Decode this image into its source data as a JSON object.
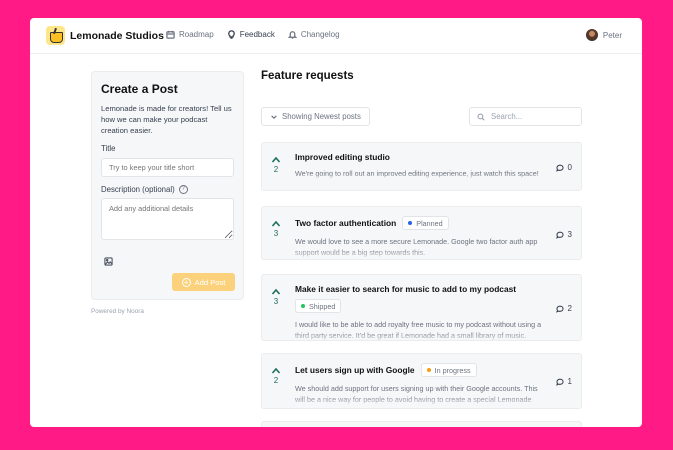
{
  "header": {
    "brand": "Lemonade Studios",
    "nav": [
      {
        "label": "Roadmap",
        "icon": "calendar-icon"
      },
      {
        "label": "Feedback",
        "icon": "lightbulb-icon"
      },
      {
        "label": "Changelog",
        "icon": "bell-icon"
      }
    ],
    "user": "Peter"
  },
  "create_post": {
    "title": "Create a Post",
    "description": "Lemonade is made for creators! Tell us how we can make your podcast creation easier.",
    "title_label": "Title",
    "title_placeholder": "Try to keep your title short",
    "desc_label": "Description (optional)",
    "desc_placeholder": "Add any additional details",
    "submit_label": "Add Post"
  },
  "footer": {
    "powered_by": "Powered by Noora"
  },
  "feed": {
    "title": "Feature requests",
    "sort_label": "Showing Newest posts",
    "search_placeholder": "Search...",
    "posts": [
      {
        "title": "Improved editing studio",
        "votes": "2",
        "comments": "0",
        "status": "",
        "desc": "We're going to roll out an improved editing experience, just watch this space!"
      },
      {
        "title": "Two factor authentication",
        "votes": "3",
        "comments": "3",
        "status": "Planned",
        "status_color": "#2563eb",
        "desc": "We would love to see a more secure Lemonade. Google two factor auth app support would be a big step towards this."
      },
      {
        "title": "Make it easier to search for music to add to my podcast",
        "votes": "3",
        "comments": "2",
        "status": "Shipped",
        "status_color": "#22c55e",
        "desc": "I would like to be able to add royalty free music to my podcast without using a third party service. It'd be great if Lemonade had a small library of music."
      },
      {
        "title": "Let users sign up with Google",
        "votes": "2",
        "comments": "1",
        "status": "In progress",
        "status_color": "#f59e0b",
        "desc": "We should add support for users signing up with their Google accounts. This will be a nice way for people to avoid having to create a special Lemonade account."
      }
    ]
  },
  "colors": {
    "background": "#ff1a85",
    "vote": "#1f6f5c",
    "button": "#fbd27b"
  }
}
